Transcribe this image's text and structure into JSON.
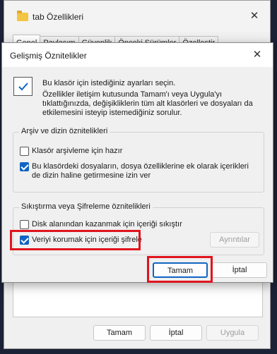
{
  "background_window": {
    "title": "tab Özellikleri",
    "close": "✕",
    "tabs": [
      "Genel",
      "Paylaşım",
      "Güvenlik",
      "Önceki Sürümler",
      "Özelleştir"
    ],
    "buttons": {
      "ok": "Tamam",
      "cancel": "İptal",
      "apply": "Uygula"
    }
  },
  "dialog": {
    "title": "Gelişmiş Öznitelikler",
    "close": "✕",
    "info_line1": "Bu klasör için istediğiniz ayarları seçin.",
    "info_line2": "Özellikler iletişim kutusunda Tamam'ı veya Uygula'yı tıklattığınızda, değişikliklerin tüm alt klasörleri ve dosyaları da etkilemesini isteyip istemediğiniz sorulur.",
    "archive_group": {
      "label": "Arşiv ve dizin öznitelikleri",
      "archive_checkbox": {
        "label": "Klasör arşivleme için hazır",
        "checked": false
      },
      "index_checkbox": {
        "label": "Bu klasördeki dosyaların, dosya özelliklerine ek olarak içerikleri de dizin haline getirmesine izin ver",
        "checked": true
      }
    },
    "compress_group": {
      "label": "Sıkıştırma veya Şifreleme öznitelikleri",
      "compress_checkbox": {
        "label": "Disk alanından kazanmak için içeriği sıkıştır",
        "checked": false
      },
      "encrypt_checkbox": {
        "label": "Veriyi korumak için içeriği şifrele",
        "checked": true
      },
      "details_button": "Ayrıntılar"
    },
    "buttons": {
      "ok": "Tamam",
      "cancel": "İptal"
    }
  },
  "colors": {
    "highlight": "#e0141e",
    "accent": "#1164c3"
  }
}
